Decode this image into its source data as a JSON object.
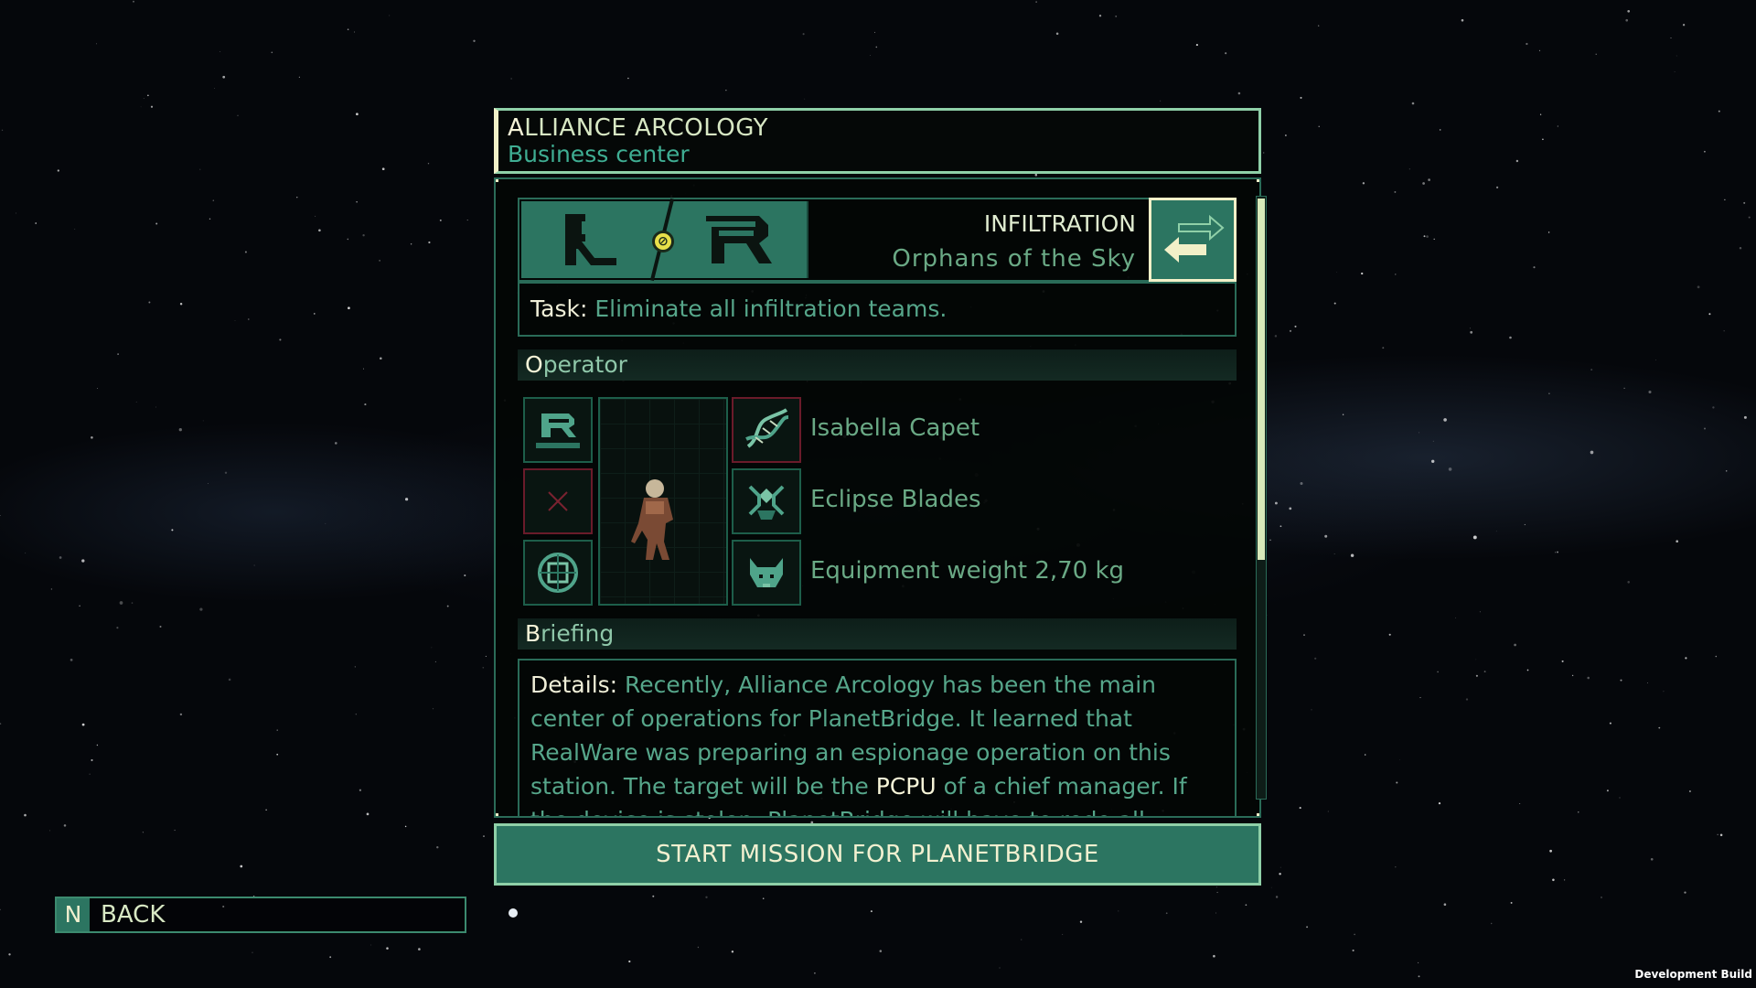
{
  "location": {
    "title_initial": "A",
    "title_rest": "LLIANCE ARCOLOGY",
    "subtitle": "Business center"
  },
  "mission": {
    "type": "INFILTRATION",
    "faction": "Orphans of the Sky",
    "faction_logos": [
      "planetbridge-logo-icon",
      "realware-logo-icon"
    ],
    "task_label": "Task:",
    "task_text": "Eliminate all infiltration teams."
  },
  "operator": {
    "section_initial": "O",
    "section_rest": "perator",
    "name": "Isabella Capet",
    "weapon": "Eclipse Blades",
    "equipment_weight": "Equipment weight 2,70 kg",
    "slots_left": [
      "realware-badge-icon",
      "empty-slot-x-icon",
      "chip-module-icon"
    ],
    "slots_right": [
      "dna-helix-icon",
      "crab-blades-icon",
      "beast-head-icon"
    ]
  },
  "briefing": {
    "section_initial": "B",
    "section_rest": "riefing",
    "details_label": "Details:",
    "details_part1": "Recently, Alliance Arcology has been the main center of operations for PlanetBridge. It learned that RealWare was preparing an espionage operation on this station. The target will be the",
    "details_highlight": "PCPU",
    "details_part2": "of a chief manager. If the device is stolen, PlanetBridge will have to redo all"
  },
  "actions": {
    "start_label": "START MISSION FOR PLANETBRIDGE",
    "back_key": "N",
    "back_label": "BACK"
  },
  "footer": {
    "dev_build": "Development Build"
  },
  "colors": {
    "accent": "#2c7561",
    "border": "#8fd0a8",
    "highlight": "#f2f0c8",
    "text_muted": "#56a68a",
    "text_light": "#d8e8c4"
  }
}
